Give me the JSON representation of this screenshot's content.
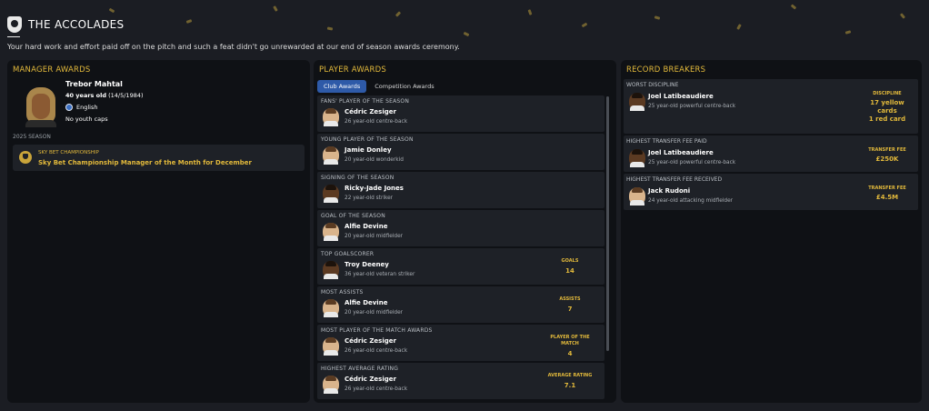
{
  "header": {
    "title": "THE ACCOLADES",
    "subtitle": "Your hard work and effort paid off on the pitch and such a feat didn't go unrewarded at our end of season awards ceremony."
  },
  "manager_awards": {
    "title": "MANAGER AWARDS",
    "name": "Trebor Mahtal",
    "age_label": "40 years old",
    "birth_date": "(14/5/1984)",
    "nationality": "English",
    "caps": "No youth caps",
    "season": "2025 SEASON",
    "award": {
      "competition": "SKY BET CHAMPIONSHIP",
      "name": "Sky Bet Championship Manager of the Month for December"
    }
  },
  "player_awards": {
    "title": "PLAYER AWARDS",
    "tabs": [
      {
        "label": "Club Awards",
        "active": true
      },
      {
        "label": "Competition Awards",
        "active": false
      }
    ],
    "rows": [
      {
        "category": "FANS' PLAYER OF THE SEASON",
        "name": "Cédric Zesiger",
        "desc": "26 year-old centre-back",
        "stat_label": "",
        "stat_value": ""
      },
      {
        "category": "YOUNG PLAYER OF THE SEASON",
        "name": "Jamie Donley",
        "desc": "20 year-old wonderkid",
        "stat_label": "",
        "stat_value": ""
      },
      {
        "category": "SIGNING OF THE SEASON",
        "name": "Ricky-Jade Jones",
        "desc": "22 year-old striker",
        "stat_label": "",
        "stat_value": ""
      },
      {
        "category": "GOAL OF THE SEASON",
        "name": "Alfie Devine",
        "desc": "20 year-old midfielder",
        "stat_label": "",
        "stat_value": ""
      },
      {
        "category": "TOP GOALSCORER",
        "name": "Troy Deeney",
        "desc": "36 year-old veteran striker",
        "stat_label": "GOALS",
        "stat_value": "14"
      },
      {
        "category": "MOST ASSISTS",
        "name": "Alfie Devine",
        "desc": "20 year-old midfielder",
        "stat_label": "ASSISTS",
        "stat_value": "7"
      },
      {
        "category": "MOST PLAYER OF THE MATCH AWARDS",
        "name": "Cédric Zesiger",
        "desc": "26 year-old centre-back",
        "stat_label": "PLAYER OF THE MATCH",
        "stat_value": "4"
      },
      {
        "category": "HIGHEST AVERAGE RATING",
        "name": "Cédric Zesiger",
        "desc": "26 year-old centre-back",
        "stat_label": "AVERAGE RATING",
        "stat_value": "7.1"
      }
    ]
  },
  "record_breakers": {
    "title": "RECORD BREAKERS",
    "rows": [
      {
        "category": "WORST DISCIPLINE",
        "name": "Joel Latibeaudiere",
        "desc": "25 year-old powerful centre-back",
        "stat_label": "DISCIPLINE",
        "stat_lines": [
          "17 yellow",
          "cards",
          "1 red card"
        ]
      },
      {
        "category": "HIGHEST TRANSFER FEE PAID",
        "name": "Joel Latibeaudiere",
        "desc": "25 year-old powerful centre-back",
        "stat_label": "TRANSFER FEE",
        "stat_lines": [
          "£250K"
        ]
      },
      {
        "category": "HIGHEST TRANSFER FEE RECEIVED",
        "name": "Jack Rudoni",
        "desc": "24 year-old attacking midfielder",
        "stat_label": "TRANSFER FEE",
        "stat_lines": [
          "£4.5M"
        ]
      }
    ]
  }
}
